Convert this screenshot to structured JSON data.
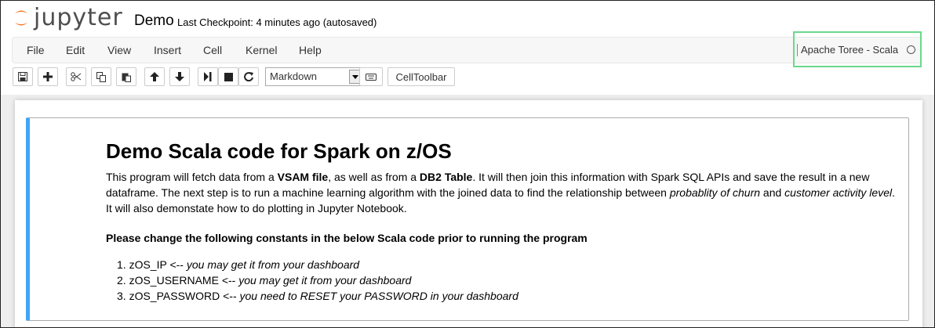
{
  "header": {
    "logo_text": "jupyter",
    "notebook_name": "Demo",
    "checkpoint_label": "Last Checkpoint: 4 minutes ago (autosaved)"
  },
  "menubar": {
    "items": [
      "File",
      "Edit",
      "View",
      "Insert",
      "Cell",
      "Kernel",
      "Help"
    ],
    "kernel_name": "Apache Toree - Scala"
  },
  "toolbar": {
    "icons": [
      "save-icon",
      "plus-icon",
      "cut-icon",
      "copy-icon",
      "paste-icon",
      "arrow-up-icon",
      "arrow-down-icon",
      "step-forward-icon",
      "stop-icon",
      "restart-icon"
    ],
    "cell_type": "Markdown",
    "celltoolbar_label": "CellToolbar"
  },
  "cell": {
    "title": "Demo Scala code for Spark on z/OS",
    "para": {
      "t1": "This program will fetch data from a ",
      "b1": "VSAM file",
      "t2": ", as well as from a ",
      "b2": "DB2 Table",
      "t3": ". It will then join this information with Spark SQL APIs and save the result in a new dataframe. The next step is to run a machine learning algorithm with the joined data to find the relationship between ",
      "i1": "probablity of churn",
      "t4": " and ",
      "i2": "customer activity level",
      "t5": ". It will also demonstate how to do plotting in Jupyter Notebook."
    },
    "note": "Please change the following constants in the below Scala code prior to running the program",
    "list": [
      {
        "num": "1.",
        "key": "zOS_IP",
        "arrow": " <-- ",
        "hint": "you may get it from your dashboard"
      },
      {
        "num": "2.",
        "key": "zOS_USERNAME",
        "arrow": " <-- ",
        "hint": "you may get it from your dashboard"
      },
      {
        "num": "3.",
        "key": "zOS_PASSWORD",
        "arrow": " <-- ",
        "hint": "you need to RESET your PASSWORD in your dashboard"
      }
    ]
  },
  "colors": {
    "selected_cell_border": "#42a5f5",
    "kernel_highlight": "#6bd98b",
    "logo_orange": "#f37626"
  }
}
